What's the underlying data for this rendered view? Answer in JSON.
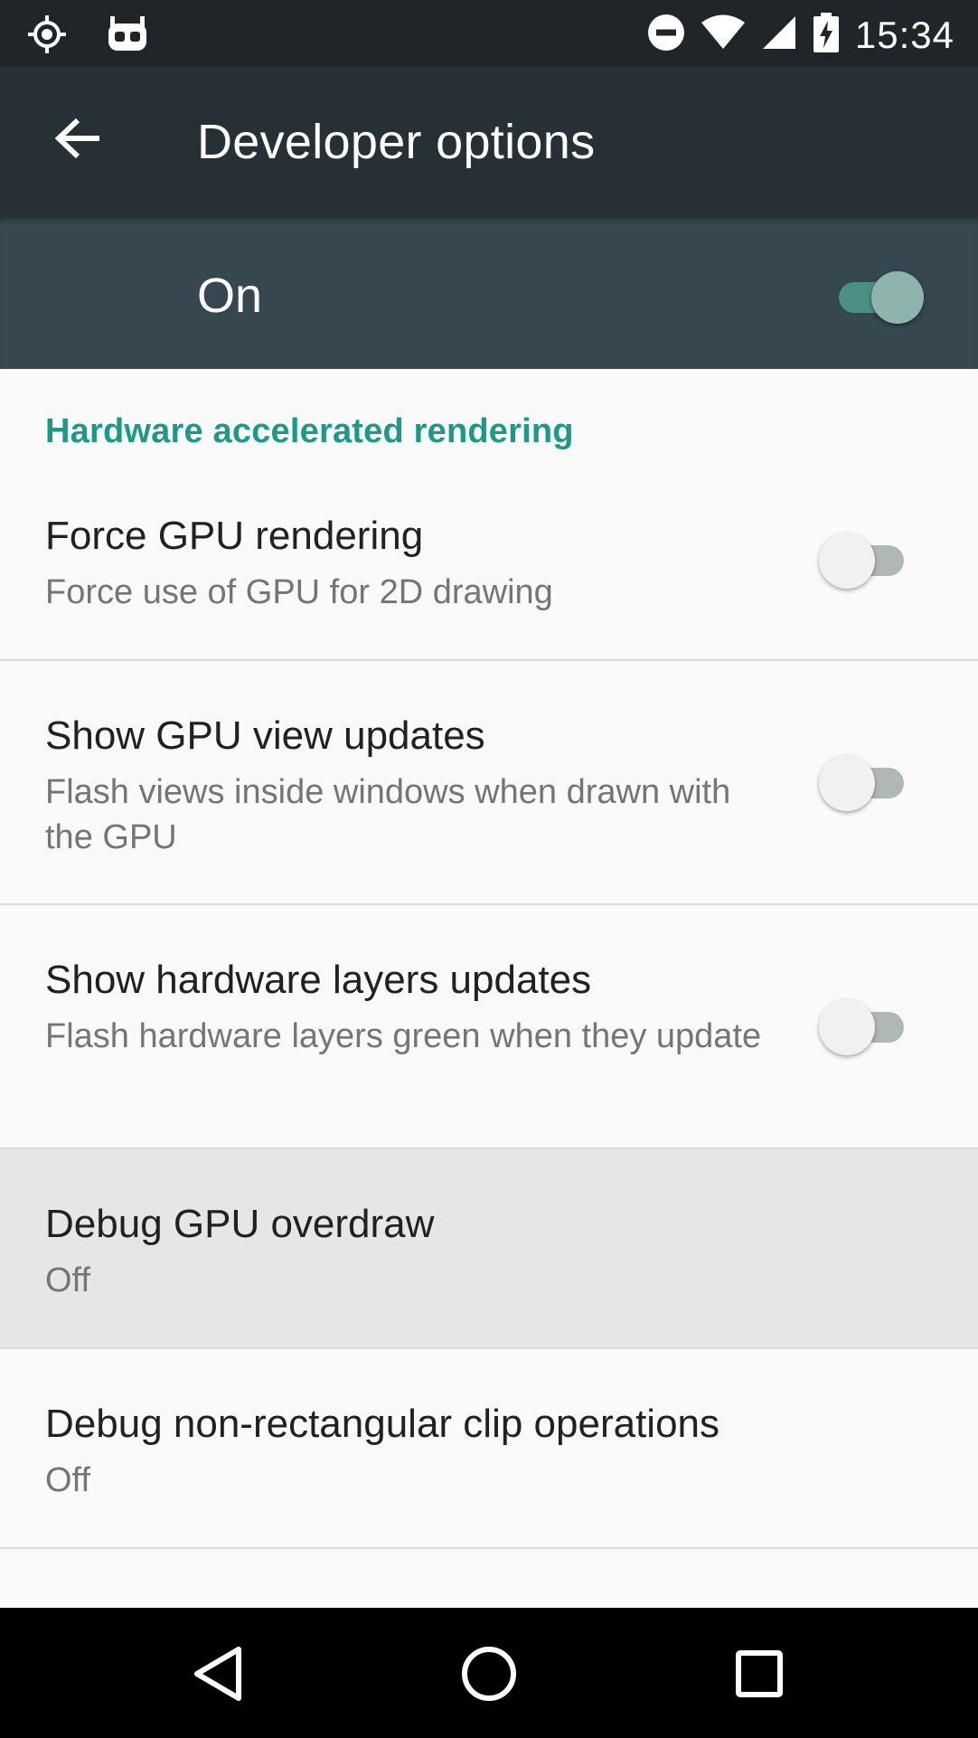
{
  "status_bar": {
    "time": "15:34",
    "icons": [
      "gps-target-icon",
      "cyanogen-bot-icon",
      "do-not-disturb-icon",
      "wifi-icon",
      "cell-signal-icon",
      "battery-charging-icon"
    ]
  },
  "app_bar": {
    "title": "Developer options",
    "back_icon": "arrow-back-icon"
  },
  "master_switch": {
    "label": "On",
    "state": "on"
  },
  "section": {
    "header": "Hardware accelerated rendering"
  },
  "settings": [
    {
      "title": "Force GPU rendering",
      "summary": "Force use of GPU for 2D drawing",
      "has_switch": true,
      "switch_state": "off"
    },
    {
      "title": "Show GPU view updates",
      "summary": "Flash views inside windows when drawn with the GPU",
      "has_switch": true,
      "switch_state": "off"
    },
    {
      "title": "Show hardware layers updates",
      "summary": "Flash hardware layers green when they update",
      "has_switch": true,
      "switch_state": "off"
    },
    {
      "title": "Debug GPU overdraw",
      "summary": "Off",
      "has_switch": false,
      "pressed": true
    },
    {
      "title": "Debug non-rectangular clip operations",
      "summary": "Off",
      "has_switch": false
    }
  ],
  "nav_bar": {
    "icons": [
      "back-triangle-icon",
      "home-circle-icon",
      "recents-square-icon"
    ]
  },
  "colors": {
    "status_bar": "#1f2528",
    "app_bar": "#263035",
    "master_bar": "#37474f",
    "accent": "#1b9a88"
  }
}
